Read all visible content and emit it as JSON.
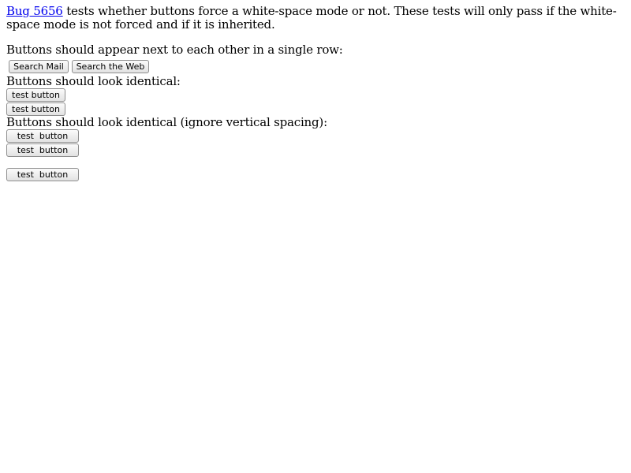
{
  "intro": {
    "link_text": "Bug 5656",
    "text": " tests whether buttons force a white-space mode or not. These tests will only pass if the white-space mode is not forced and if it is inherited."
  },
  "section1": {
    "label": "Buttons should appear next to each other in a single row:",
    "buttons": [
      "Search Mail",
      "Search the Web"
    ]
  },
  "section2": {
    "label": "Buttons should look identical:",
    "buttons": [
      "test button",
      "test button"
    ]
  },
  "section3": {
    "label": "Buttons should look identical (ignore vertical spacing):",
    "buttons": [
      "test  button",
      "test  button",
      "test  button"
    ]
  }
}
